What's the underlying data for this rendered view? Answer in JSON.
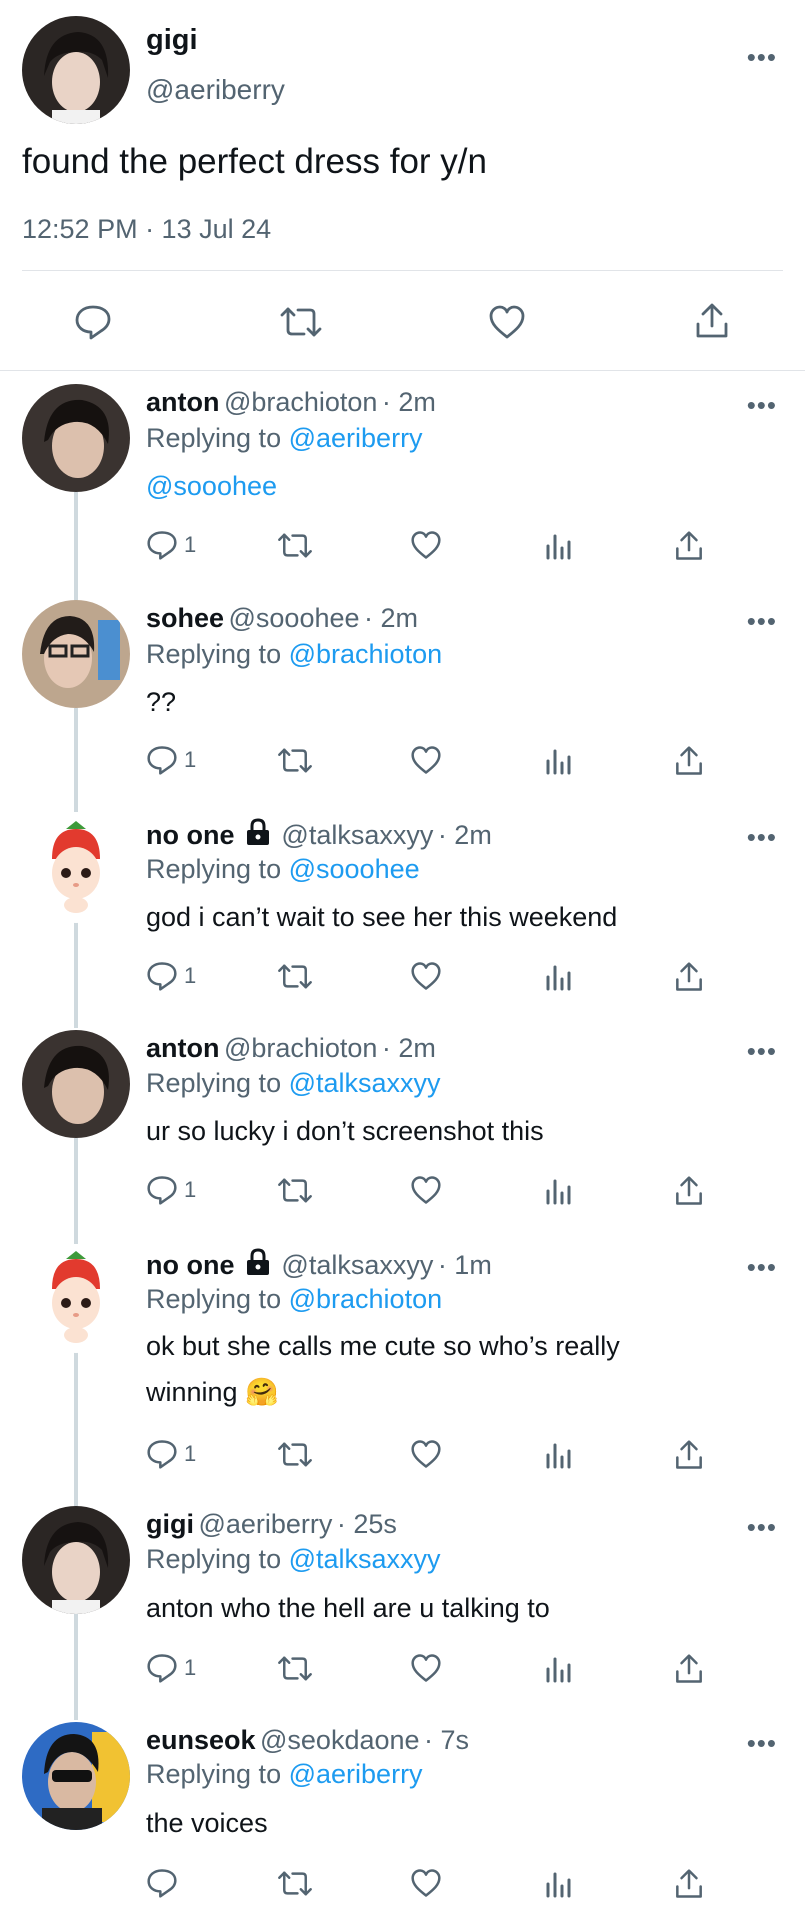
{
  "main_tweet": {
    "name": "gigi",
    "handle": "@aeriberry",
    "text": "found the perfect dress for y/n",
    "time": "12:52 PM · 13 Jul 24"
  },
  "more_glyph": "•••",
  "replying_prefix": "Replying to",
  "replies": [
    {
      "name": "anton",
      "handle": "@brachioton",
      "age": "· 2m",
      "replying_to": "@aeriberry",
      "text": "@sooohee",
      "text_is_link": true,
      "reply_count": "1"
    },
    {
      "name": "sohee",
      "handle": "@sooohee",
      "age": "· 2m",
      "replying_to": "@brachioton",
      "text": "??",
      "reply_count": "1"
    },
    {
      "name": "no one",
      "locked": true,
      "handle": "@talksaxxyy",
      "age": "· 2m",
      "replying_to": "@sooohee",
      "text": "god i can’t wait to see her this weekend",
      "reply_count": "1"
    },
    {
      "name": "anton",
      "handle": "@brachioton",
      "age": "· 2m",
      "replying_to": "@talksaxxyy",
      "text": "ur so lucky i don’t screenshot this",
      "reply_count": "1"
    },
    {
      "name": "no one",
      "locked": true,
      "handle": "@talksaxxyy",
      "age": "· 1m",
      "replying_to": "@brachioton",
      "text": "ok but she calls me cute so who’s really winning 🤗",
      "reply_count": "1"
    },
    {
      "name": "gigi",
      "handle": "@aeriberry",
      "age": "· 25s",
      "replying_to": "@talksaxxyy",
      "text": "anton who the hell are u talking to",
      "reply_count": "1"
    },
    {
      "name": "eunseok",
      "handle": "@seokdaone",
      "age": "· 7s",
      "replying_to": "@aeriberry",
      "text": "the voices",
      "reply_count": ""
    }
  ]
}
